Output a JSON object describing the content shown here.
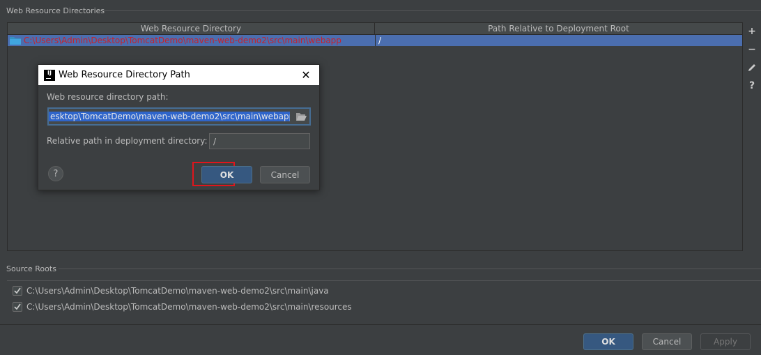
{
  "web_resource": {
    "section_title": "Web Resource Directories",
    "columns": [
      "Web Resource Directory",
      "Path Relative to Deployment Root"
    ],
    "rows": [
      {
        "directory": "C:\\Users\\Admin\\Desktop\\TomcatDemo\\maven-web-demo2\\src\\main\\webapp",
        "relative": "/"
      }
    ]
  },
  "toolbar": {
    "add": "+",
    "remove": "−",
    "help": "?"
  },
  "dialog": {
    "title": "Web Resource Directory Path",
    "close": "✕",
    "path_label": "Web resource directory path:",
    "path_value": "esktop\\TomcatDemo\\maven-web-demo2\\src\\main\\webapp",
    "relative_label": "Relative path in deployment directory:",
    "relative_value": "/",
    "help": "?",
    "ok_label": "OK",
    "cancel_label": "Cancel"
  },
  "source_roots": {
    "section_title": "Source Roots",
    "items": [
      {
        "path": "C:\\Users\\Admin\\Desktop\\TomcatDemo\\maven-web-demo2\\src\\main\\java",
        "checked": true
      },
      {
        "path": "C:\\Users\\Admin\\Desktop\\TomcatDemo\\maven-web-demo2\\src\\main\\resources",
        "checked": true
      }
    ]
  },
  "footer": {
    "ok_label": "OK",
    "cancel_label": "Cancel",
    "apply_label": "Apply"
  },
  "colors": {
    "background": "#3c3f41",
    "selection": "#4b6eaf",
    "error_path": "#c7222d",
    "primary_button": "#365880",
    "highlight": "#e0151c"
  }
}
